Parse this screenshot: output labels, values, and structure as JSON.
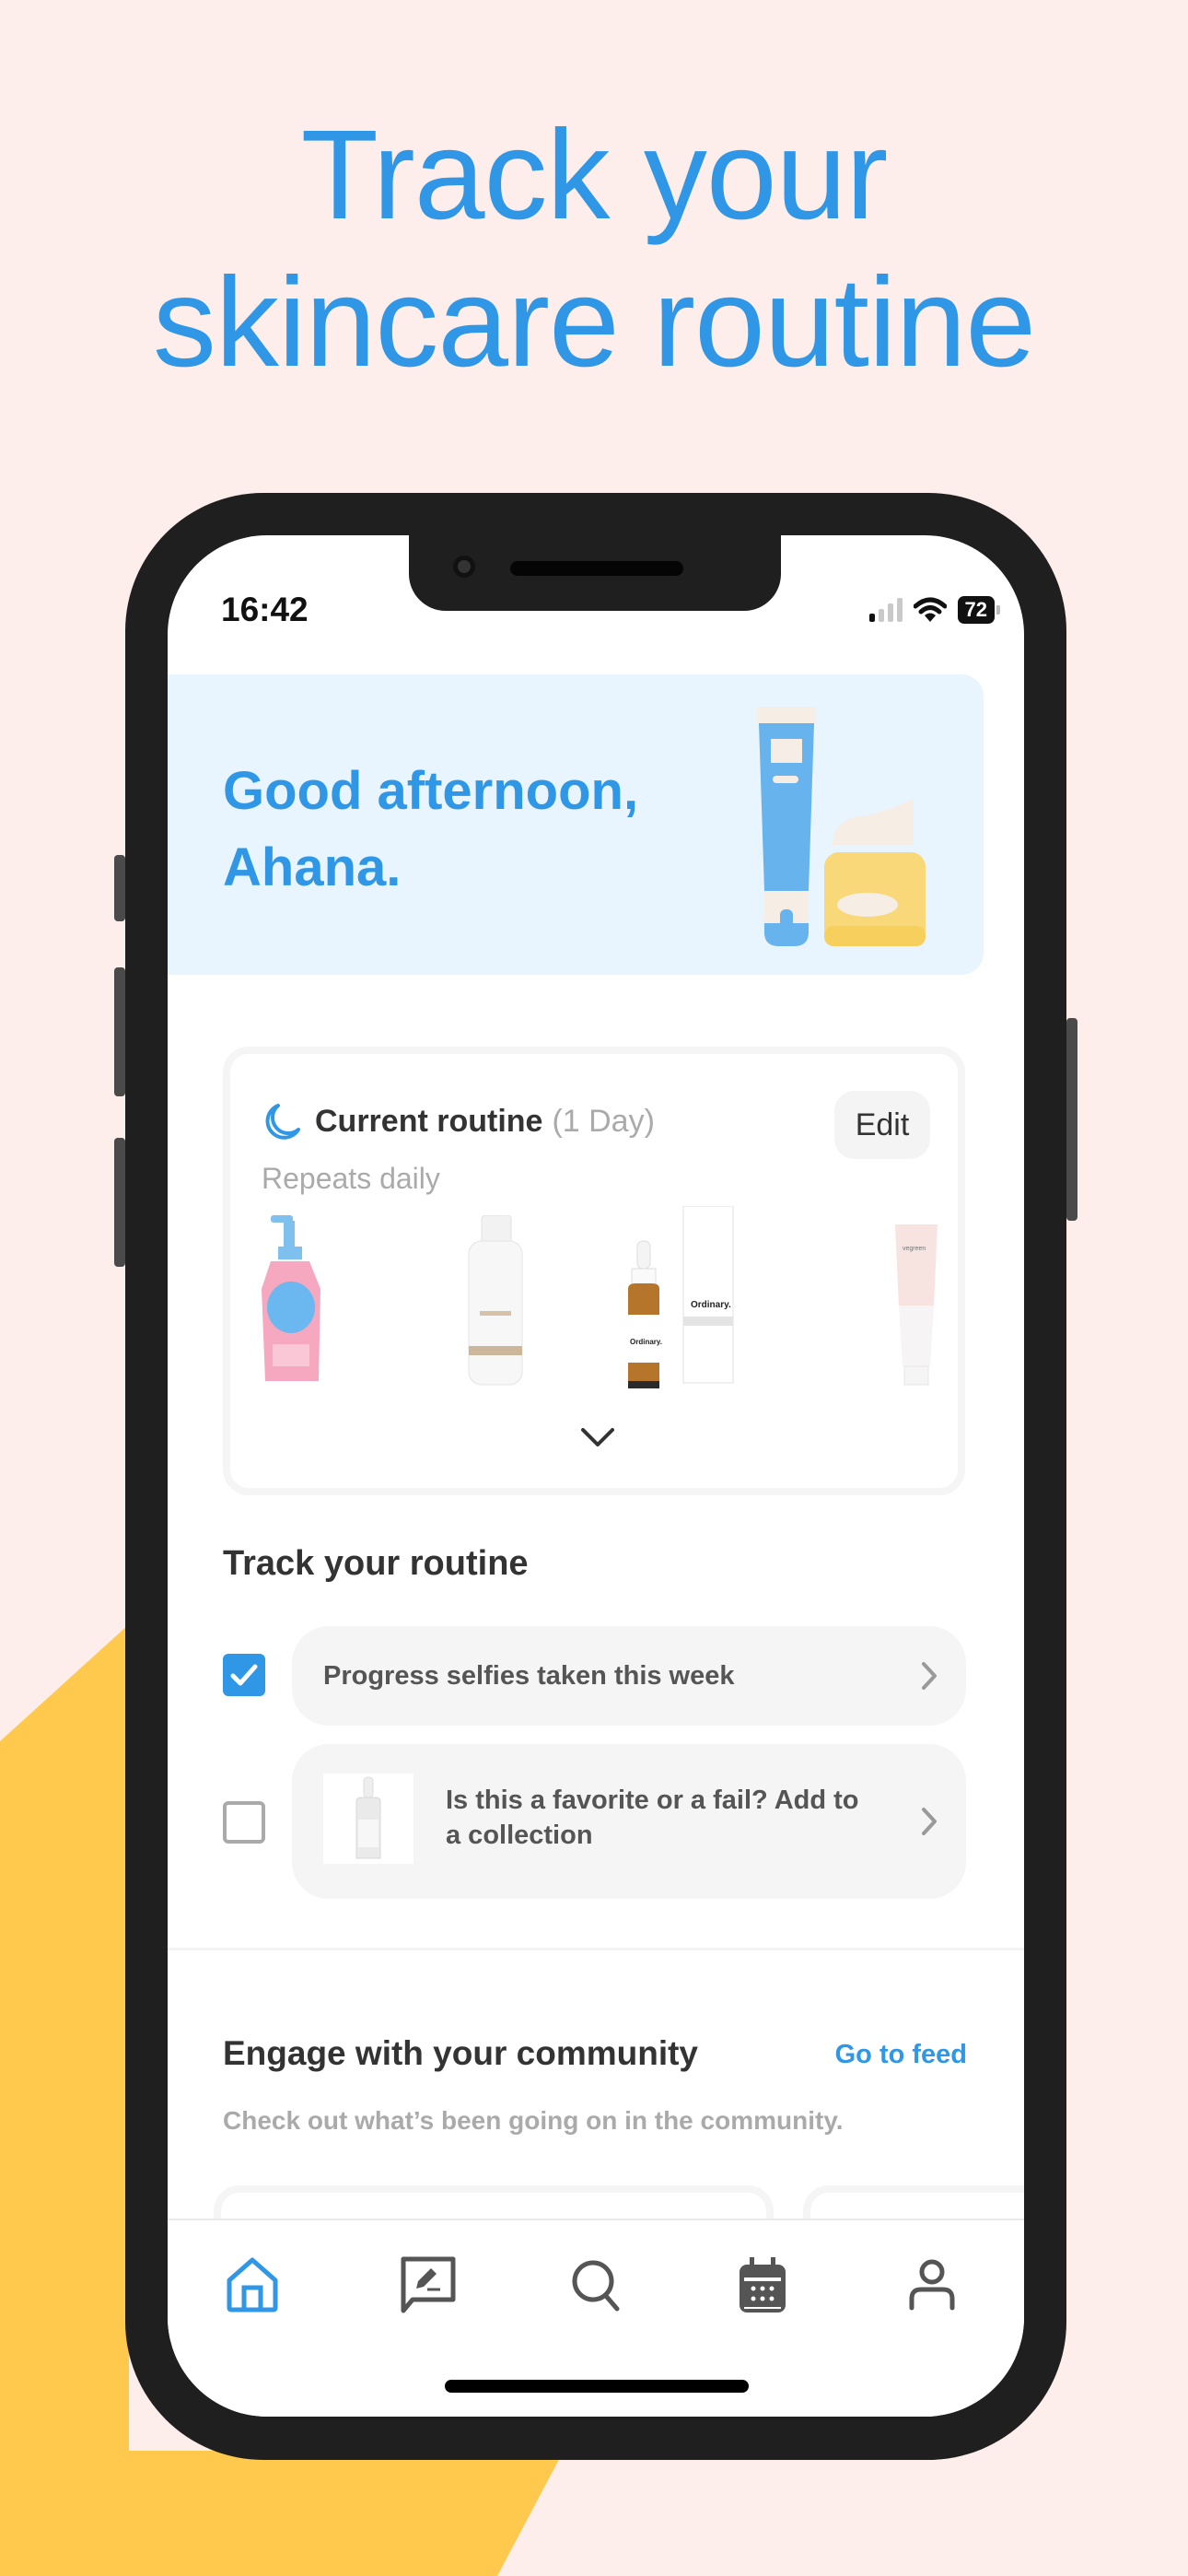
{
  "promo": {
    "headline_line1": "Track your",
    "headline_line2": "skincare routine"
  },
  "colors": {
    "accent": "#2f97e6",
    "background": "#fdeeeb",
    "yellow": "#fec94d",
    "greeting_bg": "#e8f5fe"
  },
  "status_bar": {
    "time": "16:42",
    "battery": "72",
    "signal_bars_on": 1,
    "signal_bars_total": 4
  },
  "greeting": {
    "line1": "Good afternoon,",
    "line2": "Ahana."
  },
  "routine": {
    "icon": "moon-icon",
    "title": "Current routine",
    "duration": "(1 Day)",
    "repeats": "Repeats daily",
    "edit_label": "Edit",
    "products": [
      {
        "name": "Cleansing oil (pink bottle)"
      },
      {
        "name": "Toner (white bottle)"
      },
      {
        "name": "The Ordinary serum with box"
      },
      {
        "name": "Vegreen cream tube"
      }
    ]
  },
  "track": {
    "title": "Track your routine",
    "tasks": [
      {
        "label": "Progress selfies taken this week",
        "checked": true
      },
      {
        "label": "Is this a favorite or a fail? Add to a collection",
        "checked": false
      }
    ]
  },
  "community": {
    "title": "Engage with your community",
    "link": "Go to feed",
    "subtitle": "Check out what’s been going on in the community."
  },
  "tabbar": {
    "items": [
      {
        "name": "home",
        "icon": "home-icon",
        "active": true
      },
      {
        "name": "journal",
        "icon": "journal-icon",
        "active": false
      },
      {
        "name": "search",
        "icon": "search-icon",
        "active": false
      },
      {
        "name": "calendar",
        "icon": "calendar-icon",
        "active": false
      },
      {
        "name": "profile",
        "icon": "profile-icon",
        "active": false
      }
    ]
  }
}
